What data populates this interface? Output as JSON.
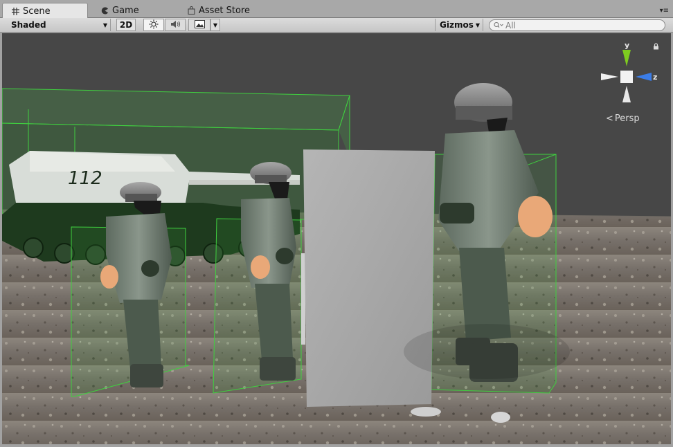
{
  "tabs": [
    {
      "label": "Scene",
      "icon": "grid-icon",
      "active": true
    },
    {
      "label": "Game",
      "icon": "pacman-icon",
      "active": false
    },
    {
      "label": "Asset Store",
      "icon": "shopping-bag-icon",
      "active": false
    }
  ],
  "toolbar": {
    "draw_mode": "Shaded",
    "mode_2d": "2D",
    "lighting_icon": "sun-icon",
    "audio_icon": "speaker-icon",
    "effects_icon": "image-icon",
    "gizmos": "Gizmos",
    "search_placeholder": "All"
  },
  "orientation_gizmo": {
    "y_label": "y",
    "z_label": "z",
    "projection": "Persp",
    "colors": {
      "y": "#7ecb20",
      "z": "#3b7de8",
      "x": "#e6e6e6"
    }
  },
  "scene": {
    "tank_number": "112",
    "selection_color": "#3fd13f"
  }
}
